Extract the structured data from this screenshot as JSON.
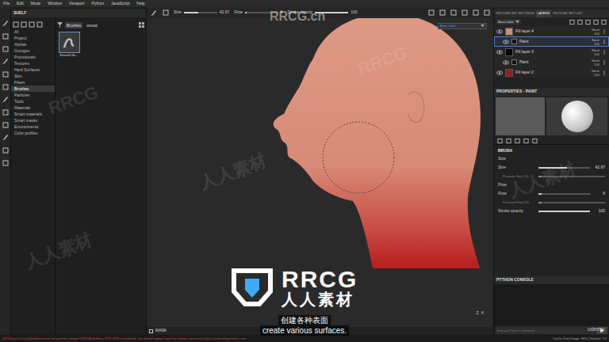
{
  "menu": [
    "File",
    "Edit",
    "Mode",
    "Window",
    "Viewport",
    "Python",
    "JavaScript",
    "Help"
  ],
  "toolbar": {
    "params": [
      {
        "label": "Size",
        "value": "42.97",
        "level": 0.43
      },
      {
        "label": "Flow",
        "value": "6",
        "level": 0.06
      },
      {
        "label": "Stroke opacity",
        "value": "100",
        "level": 1
      }
    ]
  },
  "shelf": {
    "title": "SHELF",
    "categories": [
      {
        "label": "All",
        "selected": false
      },
      {
        "label": "Project",
        "selected": false
      },
      {
        "label": "Alphas",
        "selected": false
      },
      {
        "label": "Grunges",
        "selected": false
      },
      {
        "label": "Procedurals",
        "selected": false
      },
      {
        "label": "Textures",
        "selected": false
      },
      {
        "label": "Hard Surfaces",
        "selected": false
      },
      {
        "label": "Skin",
        "selected": false
      },
      {
        "label": "Filters",
        "selected": false
      },
      {
        "label": "Brushes",
        "selected": true
      },
      {
        "label": "Particles",
        "selected": false
      },
      {
        "label": "Tools",
        "selected": false
      },
      {
        "label": "Materials",
        "selected": false
      },
      {
        "label": "Smart materials",
        "selected": false
      },
      {
        "label": "Smart masks",
        "selected": false
      },
      {
        "label": "Environments",
        "selected": false
      },
      {
        "label": "Color profiles",
        "selected": false
      }
    ],
    "filter_tag": "Brushes",
    "search": "smoot",
    "items": [
      {
        "label": "Smooth No..."
      }
    ]
  },
  "viewport": {
    "channel": "Base Color",
    "axes": [
      "Z",
      "X"
    ]
  },
  "right_tabs": [
    {
      "label": "TEXTURE SET SETTINGS",
      "selected": false
    },
    {
      "label": "LAYERS",
      "selected": true
    },
    {
      "label": "TEXTURE SET LIST",
      "selected": false
    }
  ],
  "layers": {
    "channel": "Base Color",
    "rows": [
      {
        "kind": "fill",
        "name": "Fill layer 4",
        "blend": "Norm",
        "opacity": "100",
        "color": "#c98f78",
        "selected": false
      },
      {
        "kind": "paint",
        "name": "Paint",
        "blend": "Norm",
        "opacity": "100",
        "color": "#101010",
        "selected": true
      },
      {
        "kind": "fill",
        "name": "Fill layer 3",
        "blend": "Norm",
        "opacity": "100",
        "color": "#050505",
        "selected": false
      },
      {
        "kind": "paint",
        "name": "Paint",
        "blend": "Norm",
        "opacity": "100",
        "color": "#101010",
        "selected": false
      },
      {
        "kind": "fill",
        "name": "Fill layer 2",
        "blend": "Norm",
        "opacity": "100",
        "color": "#9a1c1c",
        "selected": false
      }
    ]
  },
  "properties": {
    "title": "PROPERTIES - PAINT",
    "section": "BRUSH",
    "params": [
      {
        "kind": "heading",
        "label": "Size"
      },
      {
        "kind": "slider",
        "label": "Size",
        "value": "42.97",
        "level": 0.55
      },
      {
        "kind": "sub",
        "label": "Pressure Size (%)",
        "level": 0.05
      },
      {
        "kind": "heading",
        "label": "Flow"
      },
      {
        "kind": "slider",
        "label": "Flow",
        "value": "6",
        "level": 0.06
      },
      {
        "kind": "sub",
        "label": "Pressure Flow (%)",
        "level": 0.05
      },
      {
        "kind": "slider",
        "label": "Stroke opacity",
        "value": "100",
        "level": 1
      }
    ]
  },
  "console": {
    "title": "PYTHON CONSOLE",
    "placeholder": "Execute Python command..."
  },
  "mask": "MASK",
  "status": {
    "error": "[GPUIssuesCheck] Enabled driver for graphics adapter NVIDIA GeForce RTX 3070 is outdated. You should update them for a better experience (http://www.allegorithmic.com",
    "cache": "Cache Disk Usage:  30% | Version: 7.2"
  },
  "overlay": {
    "logo": "RRCG",
    "logo_sub": "人人素材",
    "subtitle_zh": "创建各种表面",
    "subtitle_en": "create various surfaces.",
    "top_mark": "RRCG.cn",
    "marks": [
      "RRCG",
      "人人素材",
      "RRCG",
      "人人素材",
      "人人素材"
    ],
    "udemy": "udemy"
  }
}
